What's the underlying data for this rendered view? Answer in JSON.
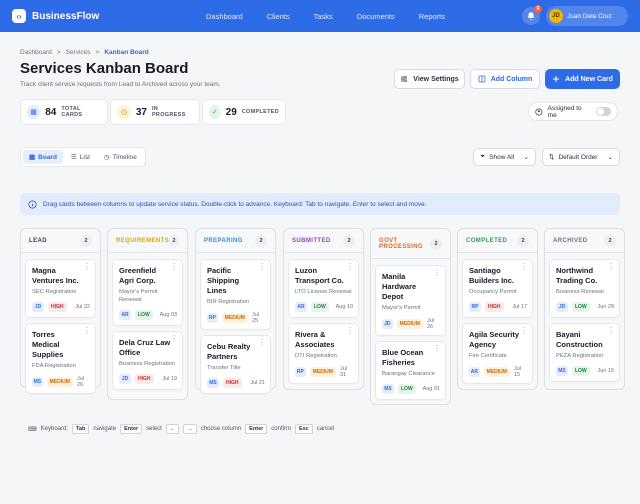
{
  "app": {
    "brand": "BusinessFlow",
    "brand_mark": "‹›",
    "nav": [
      "Dashboard",
      "Clients",
      "Tasks",
      "Documents",
      "Reports"
    ],
    "notifications": "6",
    "user": {
      "initials": "JD",
      "name": "Juan Dela Cruz"
    }
  },
  "breadcrumb": [
    "Dashboard",
    "Services",
    "Kanban Board"
  ],
  "page": {
    "title": "Services Kanban Board",
    "subtitle": "Track client service requests from Lead to Archived across your team."
  },
  "actions": {
    "view_settings": "View Settings",
    "add_column": "Add Column",
    "add_new_card": "Add New Card"
  },
  "stats": [
    {
      "value": "84",
      "label": "TOTAL CARDS",
      "icon": "grid-icon"
    },
    {
      "value": "37",
      "label": "IN PROGRESS",
      "icon": "clock-icon"
    },
    {
      "value": "29",
      "label": "COMPLETED",
      "icon": "check-icon"
    }
  ],
  "assigned_toggle": {
    "label": "Assigned to me",
    "on": false
  },
  "views": [
    "Board",
    "List",
    "Timeline"
  ],
  "filters": {
    "show": "Show All",
    "order": "Default Order"
  },
  "info": "Drag cards between columns to update service status. Double-click to advance. Keyboard: Tab to navigate, Enter to select and move.",
  "columns": [
    {
      "title": "LEAD",
      "count": "2",
      "color": "#3a4150",
      "cards": [
        {
          "title": "Magna Ventures Inc.",
          "service": "SEC Registration",
          "assignee": "JD",
          "priority": "HIGH",
          "due": "Jul 22"
        },
        {
          "title": "Torres Medical Supplies",
          "service": "FDA Registration",
          "assignee": "MS",
          "priority": "MEDIUM",
          "due": "Jul 26"
        }
      ]
    },
    {
      "title": "REQUIREMENTS",
      "count": "2",
      "color": "#e0a400",
      "cards": [
        {
          "title": "Greenfield Agri Corp.",
          "service": "Mayor's Permit Renewal",
          "assignee": "AR",
          "priority": "LOW",
          "due": "Aug 03"
        },
        {
          "title": "Dela Cruz Law Office",
          "service": "Business Registration",
          "assignee": "JD",
          "priority": "HIGH",
          "due": "Jul 19"
        }
      ]
    },
    {
      "title": "PREPARING",
      "count": "2",
      "color": "#2e8fe0",
      "cards": [
        {
          "title": "Pacific Shipping Lines",
          "service": "BIR Registration",
          "assignee": "RP",
          "priority": "MEDIUM",
          "due": "Jul 25"
        },
        {
          "title": "Cebu Realty Partners",
          "service": "Transfer Title",
          "assignee": "MS",
          "priority": "HIGH",
          "due": "Jul 21"
        }
      ]
    },
    {
      "title": "SUBMITTED",
      "count": "2",
      "color": "#9b3bc4",
      "cards": [
        {
          "title": "Luzon Transport Co.",
          "service": "LTO License Renewal",
          "assignee": "AR",
          "priority": "LOW",
          "due": "Aug 10"
        },
        {
          "title": "Rivera & Associates",
          "service": "DTI Registration",
          "assignee": "RP",
          "priority": "MEDIUM",
          "due": "Jul 31"
        }
      ]
    },
    {
      "title": "GOVT PROCESSING",
      "count": "2",
      "color": "#e5631c",
      "cards": [
        {
          "title": "Manila Hardware Depot",
          "service": "Mayor's Permit",
          "assignee": "JD",
          "priority": "MEDIUM",
          "due": "Jul 26"
        },
        {
          "title": "Blue Ocean Fisheries",
          "service": "Barangay Clearance",
          "assignee": "MS",
          "priority": "LOW",
          "due": "Aug 01"
        }
      ]
    },
    {
      "title": "COMPLETED",
      "count": "2",
      "color": "#2f9e55",
      "cards": [
        {
          "title": "Santiago Builders Inc.",
          "service": "Occupancy Permit",
          "assignee": "RP",
          "priority": "HIGH",
          "due": "Jul 17"
        },
        {
          "title": "Agila Security Agency",
          "service": "Fire Certificate",
          "assignee": "AR",
          "priority": "MEDIUM",
          "due": "Jul 15"
        }
      ]
    },
    {
      "title": "ARCHIVED",
      "count": "2",
      "color": "#6b7280",
      "cards": [
        {
          "title": "Northwind Trading Co.",
          "service": "Business Renewal",
          "assignee": "JD",
          "priority": "LOW",
          "due": "Jun 28"
        },
        {
          "title": "Bayani Construction",
          "service": "PEZA Registration",
          "assignee": "MS",
          "priority": "LOW",
          "due": "Jun 15"
        }
      ]
    }
  ],
  "keyboard": {
    "label": "Keyboard:",
    "items": [
      {
        "key": "Tab",
        "text": "navigate"
      },
      {
        "key": "Enter",
        "text": "select"
      },
      {
        "key": "←",
        "text": ""
      },
      {
        "key": "→",
        "text": "choose column"
      },
      {
        "key": "Enter",
        "text": "confirm"
      },
      {
        "key": "Esc",
        "text": "cancel"
      }
    ]
  }
}
